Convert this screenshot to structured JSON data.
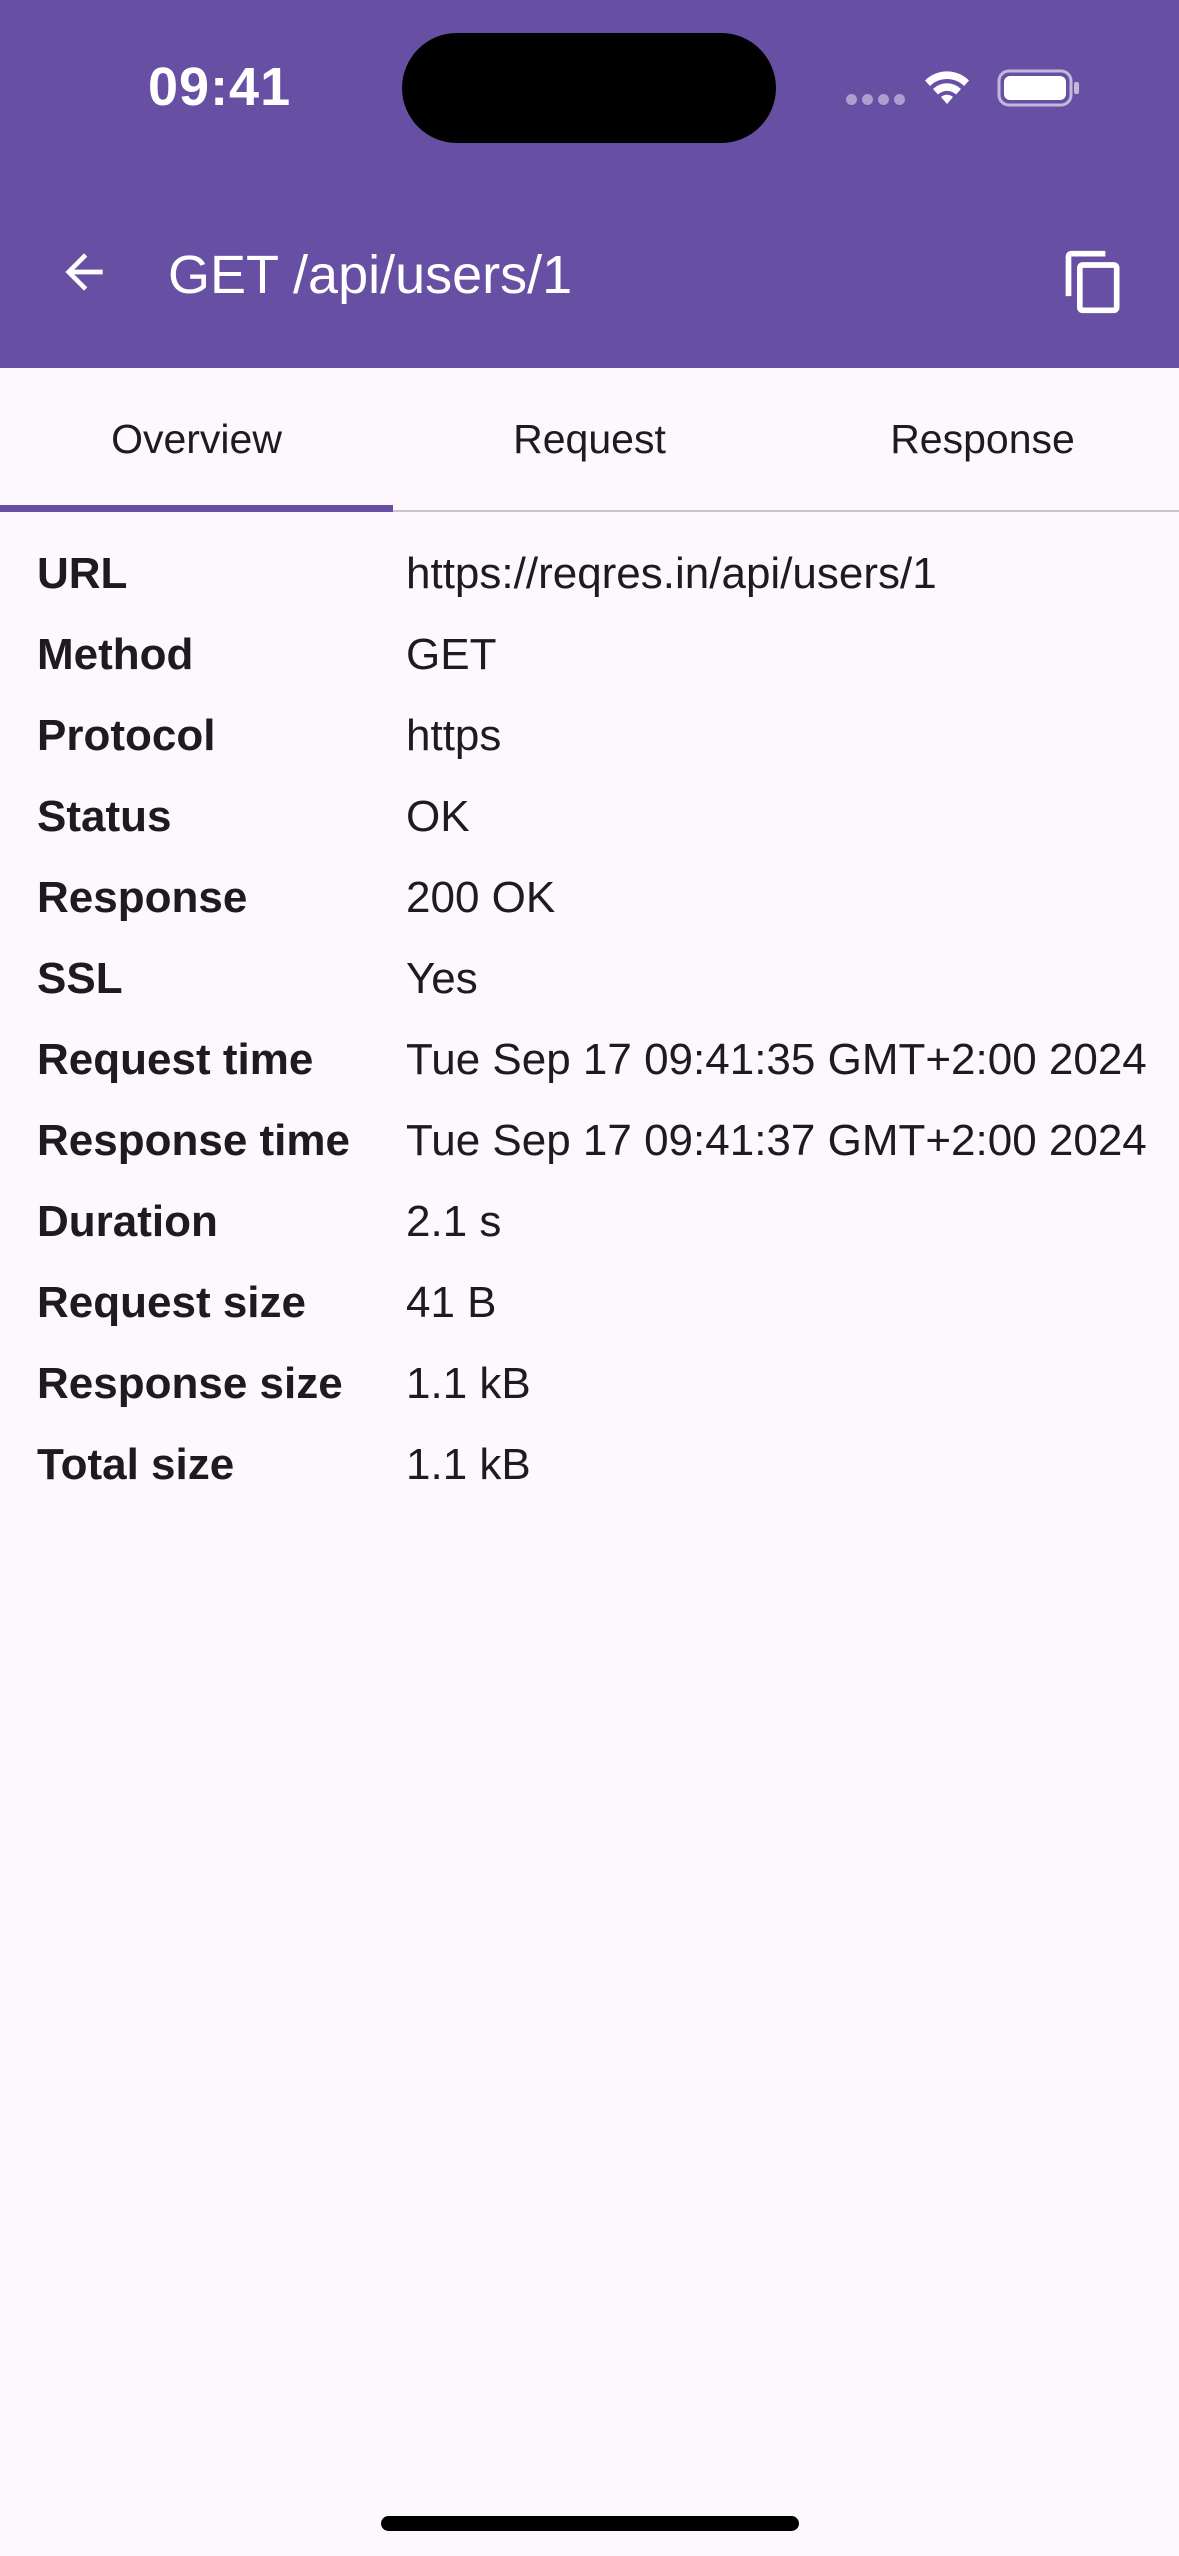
{
  "status_bar": {
    "time": "09:41"
  },
  "app_bar": {
    "title": "GET /api/users/1",
    "back_icon": "arrow-back-icon",
    "copy_icon": "copy-icon"
  },
  "tabs": [
    {
      "label": "Overview",
      "active": true
    },
    {
      "label": "Request",
      "active": false
    },
    {
      "label": "Response",
      "active": false
    }
  ],
  "details": [
    {
      "label": "URL",
      "value": "https://reqres.in/api/users/1"
    },
    {
      "label": "Method",
      "value": "GET"
    },
    {
      "label": "Protocol",
      "value": "https"
    },
    {
      "label": "Status",
      "value": "OK"
    },
    {
      "label": "Response",
      "value": "200 OK"
    },
    {
      "label": "SSL",
      "value": "Yes"
    },
    {
      "label": "Request time",
      "value": "Tue Sep 17 09:41:35 GMT+2:00 2024"
    },
    {
      "label": "Response time",
      "value": "Tue Sep 17 09:41:37 GMT+2:00 2024"
    },
    {
      "label": "Duration",
      "value": "2.1 s"
    },
    {
      "label": "Request size",
      "value": "41 B"
    },
    {
      "label": "Response size",
      "value": "1.1 kB"
    },
    {
      "label": "Total size",
      "value": "1.1 kB"
    }
  ],
  "colors": {
    "primary": "#6750a4",
    "background": "#fdf7fe",
    "text": "#1d1b20",
    "divider": "#cac4d0"
  }
}
